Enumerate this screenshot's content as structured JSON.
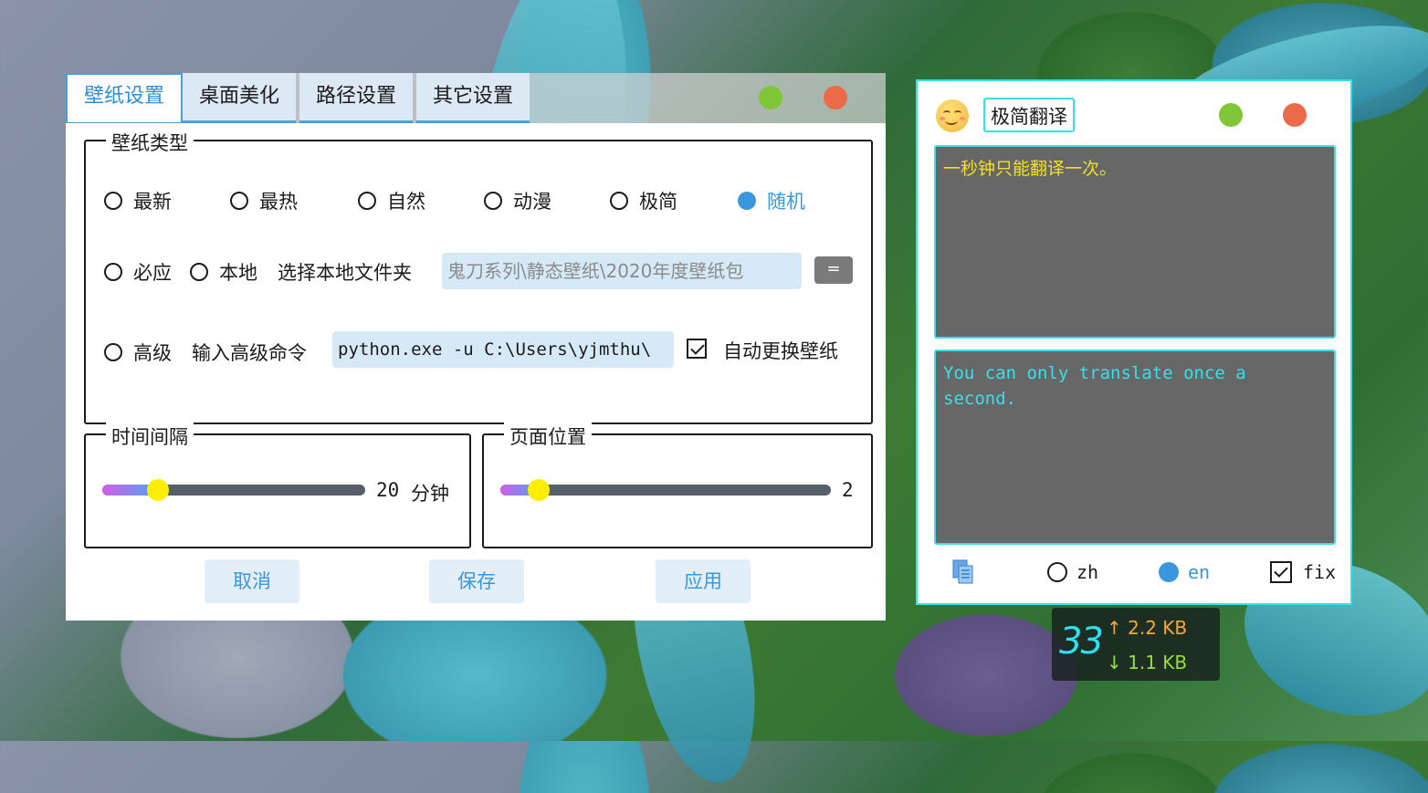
{
  "settings_window": {
    "tabs": [
      {
        "label": "壁纸设置",
        "active": true
      },
      {
        "label": "桌面美化",
        "active": false
      },
      {
        "label": "路径设置",
        "active": false
      },
      {
        "label": "其它设置",
        "active": false
      }
    ],
    "wallpaper_type": {
      "title": "壁纸类型",
      "options": [
        "最新",
        "最热",
        "自然",
        "动漫",
        "极简",
        "随机",
        "必应",
        "本地",
        "高级"
      ],
      "selected": "随机",
      "local_folder_label": "选择本地文件夹",
      "local_folder_placeholder": "鬼刀系列\\静态壁纸\\2020年度壁纸包",
      "browse_button": "=",
      "advanced_command_label": "输入高级命令",
      "advanced_command_value": "python.exe -u C:\\Users\\yjmthu\\",
      "auto_change_label": "自动更换壁纸",
      "auto_change_checked": true
    },
    "interval": {
      "title": "时间间隔",
      "value": "20",
      "unit": "分钟",
      "slider_fraction": 0.19
    },
    "page_position": {
      "title": "页面位置",
      "value": "2",
      "slider_fraction": 0.1
    },
    "buttons": {
      "cancel": "取消",
      "save": "保存",
      "apply": "应用"
    },
    "colors": {
      "accent": "#3a96dd",
      "min_dot": "#7fc638",
      "close_dot": "#ec6a4a"
    }
  },
  "translator_window": {
    "title": "极简翻译",
    "source_text": "一秒钟只能翻译一次。",
    "translated_text": "You can only translate once a second.",
    "languages": [
      {
        "label": "zh",
        "checked": false
      },
      {
        "label": "en",
        "checked": true
      }
    ],
    "fix_label": "fix",
    "fix_checked": true,
    "icons": {
      "avatar": "smiley-icon",
      "copy": "copy-icon"
    },
    "colors": {
      "border": "#35e2e7",
      "source_text": "#f2e21c",
      "translated_text": "#35e2e7",
      "box_bg": "#676767"
    }
  },
  "network_widget": {
    "main_number": "33",
    "upload_arrow": "↑",
    "upload": "2.2 KB",
    "download_arrow": "↓",
    "download": "1.1 KB"
  }
}
